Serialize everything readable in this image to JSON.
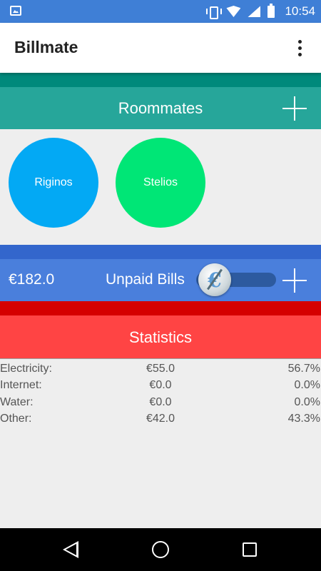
{
  "status_bar": {
    "time": "10:54",
    "icons": [
      "image-notification-icon",
      "vibrate-icon",
      "wifi-icon",
      "cell-signal-icon",
      "battery-icon"
    ]
  },
  "app_bar": {
    "title": "Billmate",
    "overflow_icon": "more-vert-icon"
  },
  "roommates": {
    "title": "Roommates",
    "add_icon": "plus-icon",
    "people": [
      {
        "name": "Riginos",
        "color": "#03a9f4"
      },
      {
        "name": "Stelios",
        "color": "#00e676"
      }
    ]
  },
  "unpaid_bills": {
    "total": "€182.0",
    "title": "Unpaid Bills",
    "toggle_icon": "euro-coin-icon",
    "add_icon": "plus-icon"
  },
  "statistics": {
    "title": "Statistics",
    "rows": [
      {
        "label": "Electricity:",
        "amount": "€55.0",
        "percent": "56.7%"
      },
      {
        "label": "Internet:",
        "amount": "€0.0",
        "percent": "0.0%"
      },
      {
        "label": "Water:",
        "amount": "€0.0",
        "percent": "0.0%"
      },
      {
        "label": "Other:",
        "amount": "€42.0",
        "percent": "43.3%"
      }
    ]
  },
  "nav_bar": {
    "icons": [
      "back-icon",
      "home-icon",
      "recents-icon"
    ]
  },
  "colors": {
    "status_bar": "#3f7fd6",
    "roommates_dark": "#00897b",
    "roommates": "#26a69a",
    "unpaid_dark": "#3366cc",
    "unpaid": "#4a7fdc",
    "stats_dark": "#d50000",
    "stats": "#ff4444"
  }
}
